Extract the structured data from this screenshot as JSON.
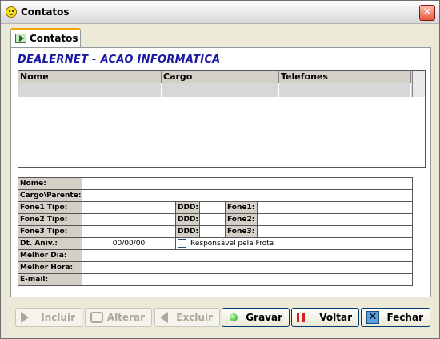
{
  "window": {
    "title": "Contatos",
    "close_glyph": "✕"
  },
  "tab": {
    "label": "Contatos"
  },
  "company": "DEALERNET - ACAO INFORMATICA",
  "grid": {
    "columns": [
      "Nome",
      "Cargo",
      "Telefones"
    ]
  },
  "form": {
    "nome": "Nome:",
    "cargo": "Cargo\\Parente:",
    "fone1_tipo": "Fone1 Tipo:",
    "fone2_tipo": "Fone2 Tipo:",
    "fone3_tipo": "Fone3 Tipo:",
    "ddd": "DDD:",
    "fone1": "Fone1:",
    "fone2": "Fone2:",
    "fone3": "Fone3:",
    "dt_aniv": "Dt. Aniv.:",
    "dt_aniv_value": "00/00/00",
    "responsavel": "Responsável pela Frota",
    "melhor_dia": "Melhor Dia:",
    "melhor_hora": "Melhor Hora:",
    "email": "E-mail:"
  },
  "buttons": {
    "incluir": "Incluir",
    "alterar": "Alterar",
    "excluir": "Excluir",
    "gravar": "Gravar",
    "voltar": "Voltar",
    "fechar": "Fechar"
  }
}
